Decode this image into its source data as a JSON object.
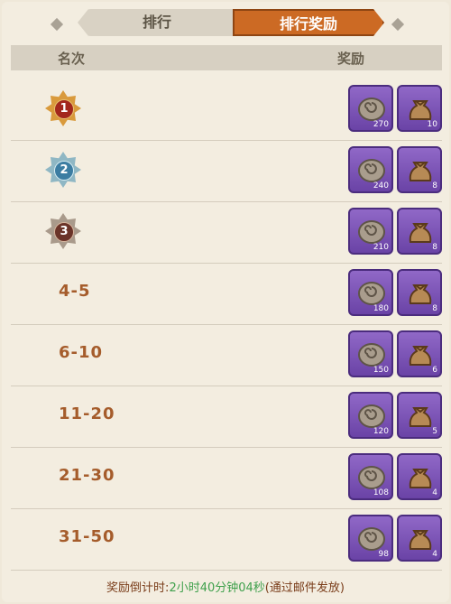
{
  "tabs": [
    {
      "label": "排行"
    },
    {
      "label": "排行奖励"
    }
  ],
  "header": {
    "rank": "名次",
    "reward": "奖励"
  },
  "rows": [
    {
      "rank": "1",
      "item1_qty": "270",
      "item2_qty": "10"
    },
    {
      "rank": "2",
      "item1_qty": "240",
      "item2_qty": "8"
    },
    {
      "rank": "3",
      "item1_qty": "210",
      "item2_qty": "8"
    },
    {
      "rank": "4-5",
      "item1_qty": "180",
      "item2_qty": "8"
    },
    {
      "rank": "6-10",
      "item1_qty": "150",
      "item2_qty": "6"
    },
    {
      "rank": "11-20",
      "item1_qty": "120",
      "item2_qty": "5"
    },
    {
      "rank": "21-30",
      "item1_qty": "108",
      "item2_qty": "4"
    },
    {
      "rank": "31-50",
      "item1_qty": "98",
      "item2_qty": "4"
    }
  ],
  "footer": {
    "prefix": "奖励倒计时:",
    "time": "2小时40分钟04秒",
    "suffix": "(通过邮件发放)"
  }
}
